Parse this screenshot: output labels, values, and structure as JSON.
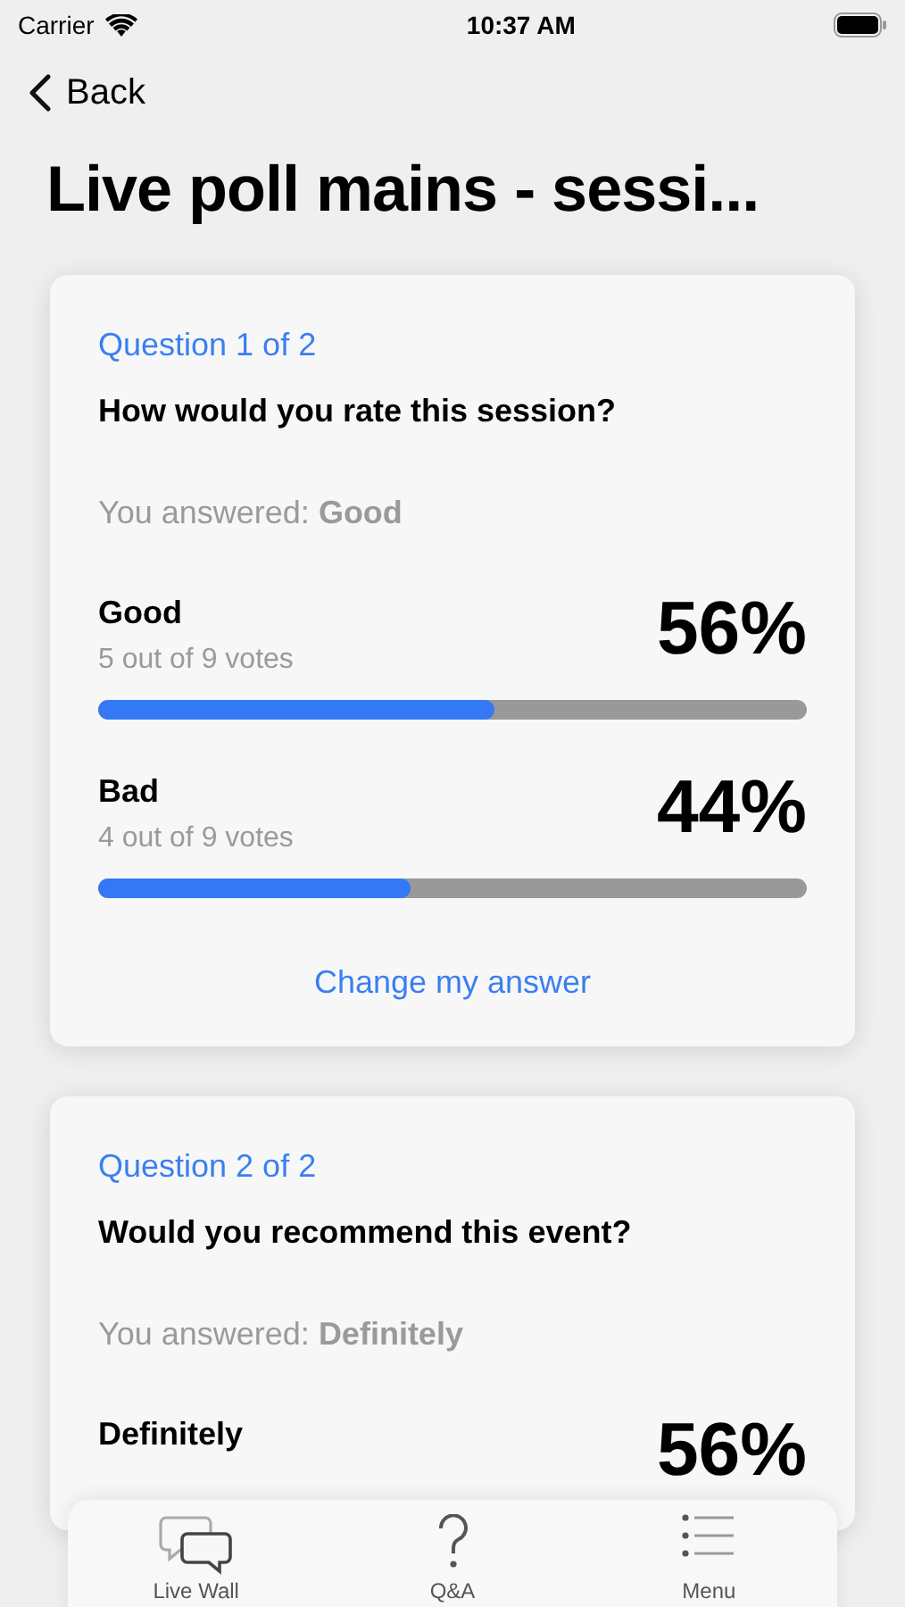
{
  "status_bar": {
    "carrier": "Carrier",
    "time": "10:37 AM"
  },
  "nav": {
    "back": "Back",
    "title": "Live poll mains - sessi..."
  },
  "questions": [
    {
      "counter": "Question 1 of 2",
      "question": "How would you rate this session?",
      "answered": "You answered: **Good**",
      "options": [
        {
          "label": "Good",
          "votes": "5 out of 9 votes",
          "percent": "56%",
          "level": 0.56
        },
        {
          "label": "Bad",
          "votes": "4 out of 9 votes",
          "percent": "44%",
          "level": 0.44
        }
      ],
      "change": "Change my answer"
    },
    {
      "counter": "Question 2 of 2",
      "question": "Would you recommend this event?",
      "answered": "You answered: **Definitely**",
      "options": [
        {
          "label": "Definitely",
          "percent": "56%"
        }
      ]
    }
  ],
  "tab_bar": [
    {
      "kind": "chat",
      "label": "Live Wall"
    },
    {
      "kind": "question",
      "label": "Q&A"
    },
    {
      "kind": "menu",
      "label": "Menu"
    }
  ]
}
